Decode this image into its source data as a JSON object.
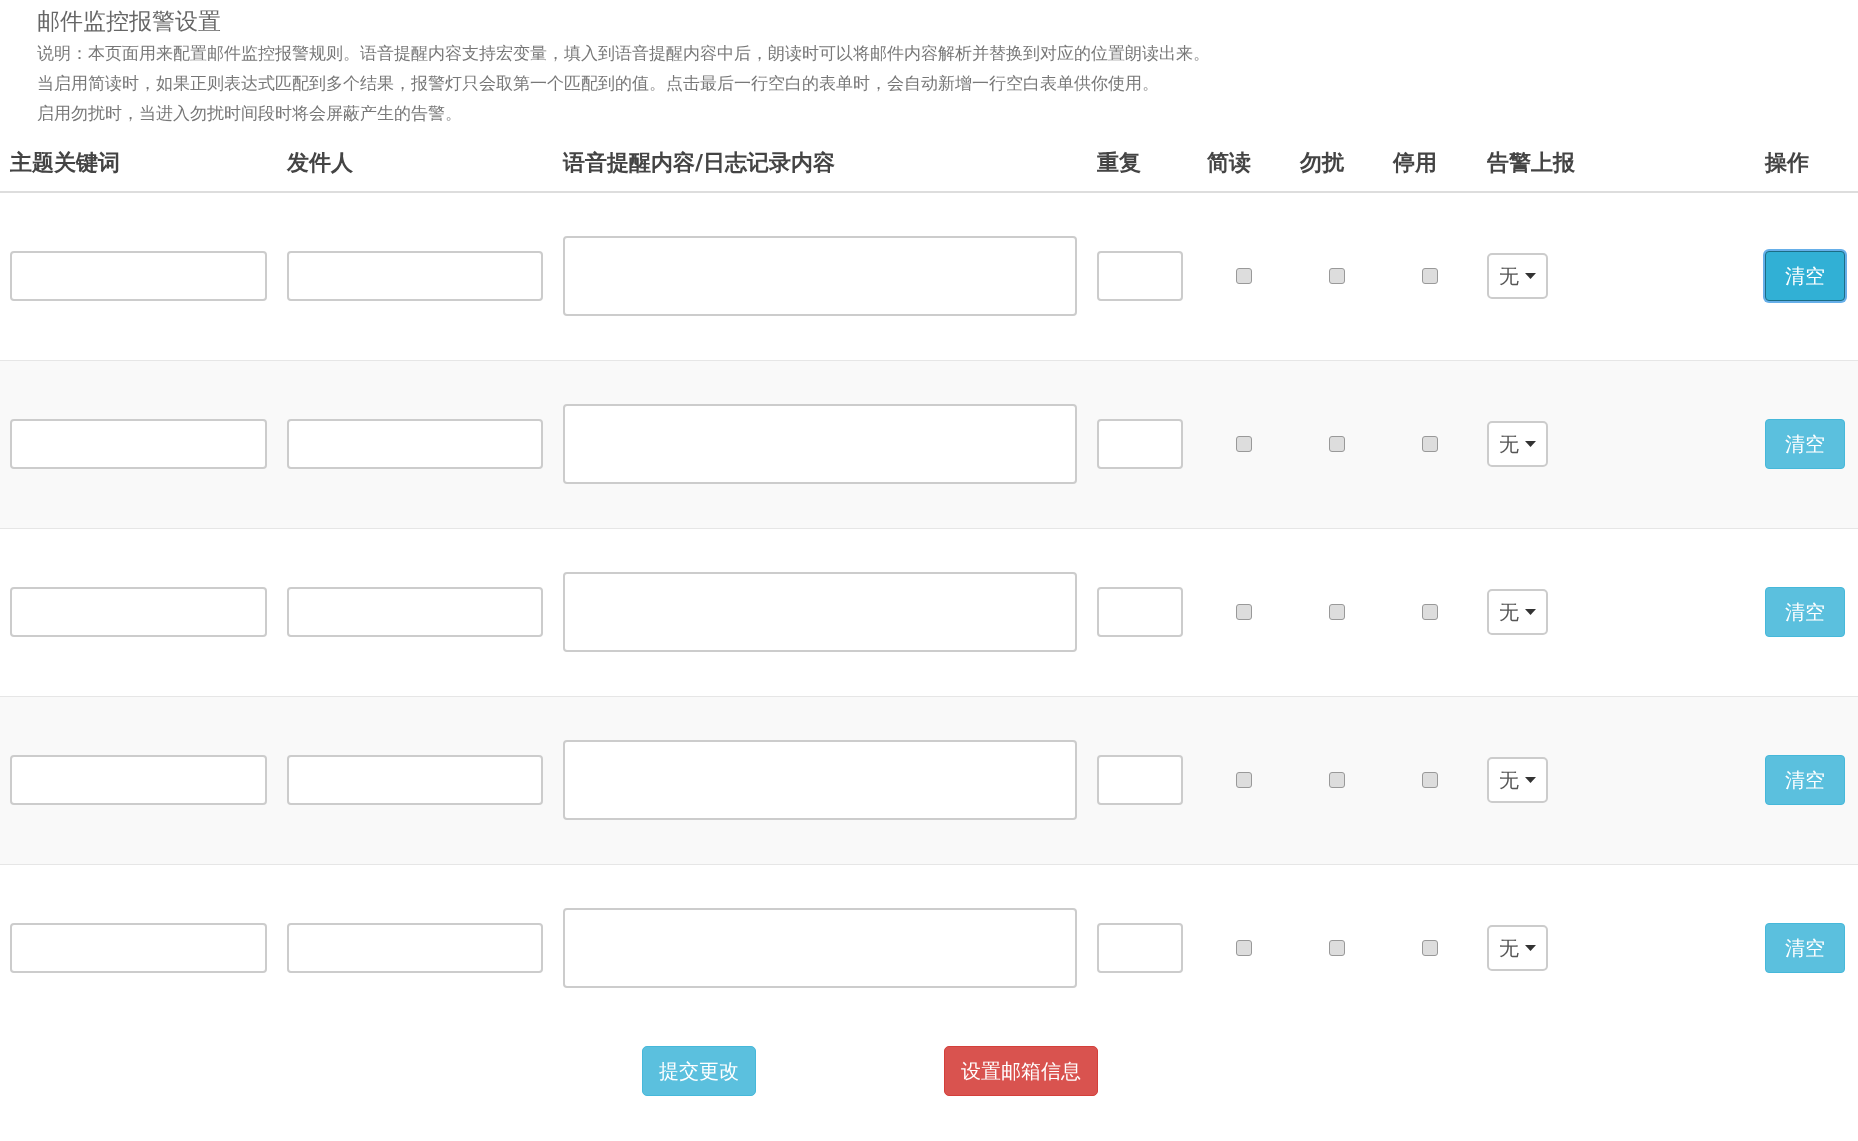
{
  "title": "邮件监控报警设置",
  "description": [
    "说明：本页面用来配置邮件监控报警规则。语音提醒内容支持宏变量，填入到语音提醒内容中后，朗读时可以将邮件内容解析并替换到对应的位置朗读出来。",
    "当启用简读时，如果正则表达式匹配到多个结果，报警灯只会取第一个匹配到的值。点击最后一行空白的表单时，会自动新增一行空白表单供你使用。",
    "启用勿扰时，当进入勿扰时间段时将会屏蔽产生的告警。"
  ],
  "columns": [
    "主题关键词",
    "发件人",
    "语音提醒内容/日志记录内容",
    "重复",
    "简读",
    "勿扰",
    "停用",
    "告警上报",
    "操作"
  ],
  "rows": [
    {
      "brief": false,
      "no_disturb": false,
      "disabled": false,
      "alert_report": "无",
      "clear_button": "清空",
      "focused": true
    },
    {
      "brief": false,
      "no_disturb": false,
      "disabled": false,
      "alert_report": "无",
      "clear_button": "清空",
      "focused": false
    },
    {
      "brief": false,
      "no_disturb": false,
      "disabled": false,
      "alert_report": "无",
      "clear_button": "清空",
      "focused": false
    },
    {
      "brief": false,
      "no_disturb": false,
      "disabled": false,
      "alert_report": "无",
      "clear_button": "清空",
      "focused": false
    },
    {
      "brief": false,
      "no_disturb": false,
      "disabled": false,
      "alert_report": "无",
      "clear_button": "清空",
      "focused": false
    }
  ],
  "buttons": [
    {
      "label": "提交更改",
      "kind": "info"
    },
    {
      "label": "设置邮箱信息",
      "kind": "danger"
    }
  ]
}
